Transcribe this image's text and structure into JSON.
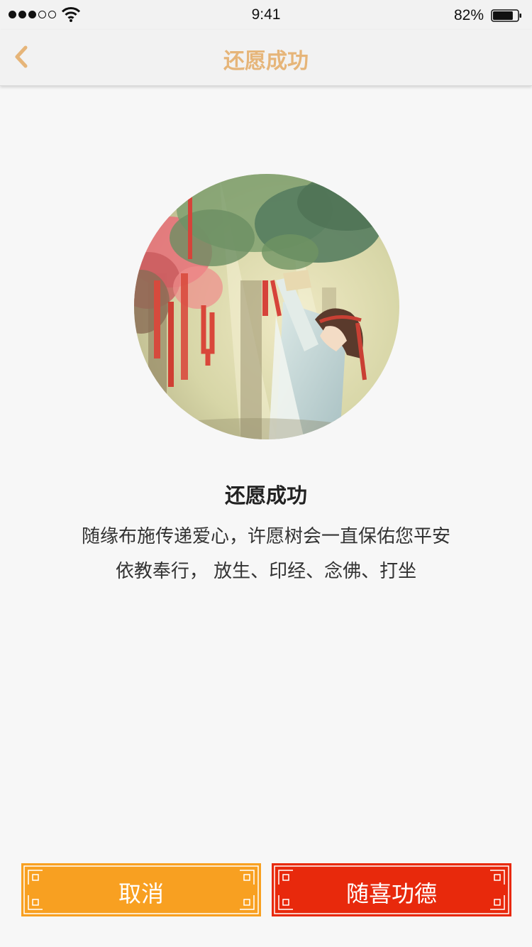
{
  "status_bar": {
    "time": "9:41",
    "battery_percent": "82%",
    "battery_level": 0.82,
    "signal_bars_filled": 3,
    "signal_bars_total": 5
  },
  "nav": {
    "title": "还愿成功",
    "back_icon": "chevron-left-icon",
    "accent_color": "#e6b579"
  },
  "content": {
    "title": "还愿成功",
    "line1": "随缘布施传递爱心，许愿树会一直保佑您平安",
    "line2": "依教奉行， 放生、印经、念佛、打坐"
  },
  "buttons": {
    "cancel_label": "取消",
    "merit_label": "随喜功德",
    "cancel_color": "#f8a021",
    "merit_color": "#e8290c"
  }
}
